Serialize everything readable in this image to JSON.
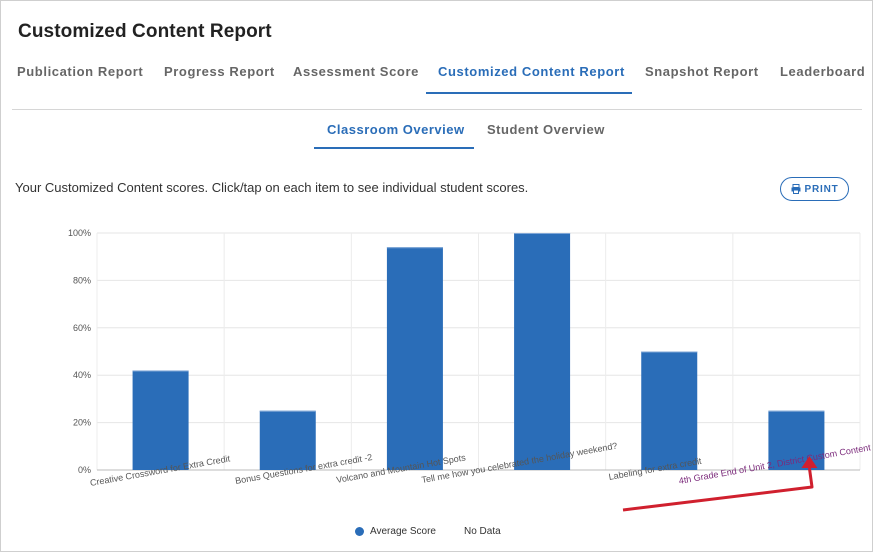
{
  "page": {
    "title": "Customized Content Report",
    "description": "Your Customized Content scores. Click/tap on each item to see individual student scores.",
    "print_label": "PRINT"
  },
  "tabs": [
    {
      "label": "Publication Report"
    },
    {
      "label": "Progress Report"
    },
    {
      "label": "Assessment Score"
    },
    {
      "label": "Customized Content Report"
    },
    {
      "label": "Snapshot Report"
    },
    {
      "label": "Leaderboard"
    }
  ],
  "subtabs": [
    {
      "label": "Classroom Overview"
    },
    {
      "label": "Student Overview"
    }
  ],
  "legend": {
    "average": "Average Score",
    "nodata": "No Data"
  },
  "colors": {
    "accent": "#2a6db8",
    "bar": "#2a6db8",
    "arrow": "#d0202e"
  },
  "chart_data": {
    "type": "bar",
    "categories": [
      "Creative Crossword for Extra Credit",
      "Bonus Questions for extra credit -2",
      "Volcano and Mountain Hot Spots",
      "Tell me how you celebrated the holiday weekend?",
      "Labeling for extra credit",
      "4th Grade End of Unit 2, District Custom Content"
    ],
    "series": [
      {
        "name": "Average Score",
        "values": [
          42,
          25,
          94,
          100,
          50,
          25
        ]
      }
    ],
    "yticks": [
      "0%",
      "20%",
      "40%",
      "60%",
      "80%",
      "100%"
    ],
    "ylim": [
      0,
      100
    ],
    "grid": true,
    "legend_position": "bottom",
    "highlighted_category": "4th Grade End of Unit 2, District Custom Content"
  }
}
